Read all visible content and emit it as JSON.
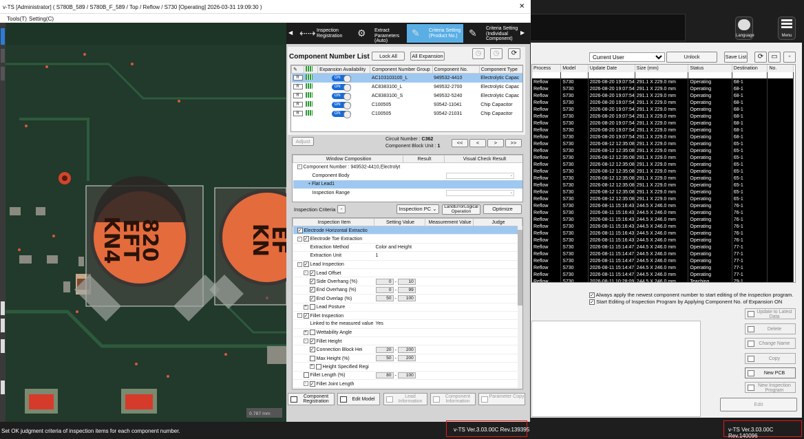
{
  "bg_app": {
    "language_label": "Language",
    "menu_label": "Menu",
    "user_select": "Current User",
    "unlock_label": "Unlock",
    "save_list_label": "Save List",
    "columns": [
      "Process",
      "Model",
      "Update Date",
      "Size (mm)",
      "Status",
      "Destination",
      "No."
    ],
    "rows": [
      [
        "Reflow",
        "S730",
        "2026-08-20 19:07:54",
        "291.1 X 229.0 mm",
        "Operating",
        "68-1"
      ],
      [
        "Reflow",
        "S730",
        "2026-08-20 19:07:54",
        "291.1 X 229.0 mm",
        "Operating",
        "68-1"
      ],
      [
        "Reflow",
        "S730",
        "2026-08-20 19:07:54",
        "291.1 X 229.0 mm",
        "Operating",
        "68-1"
      ],
      [
        "Reflow",
        "S730",
        "2026-08-20 19:07:54",
        "291.1 X 229.0 mm",
        "Operating",
        "68-1"
      ],
      [
        "Reflow",
        "S730",
        "2026-08-20 19:07:54",
        "291.1 X 229.0 mm",
        "Operating",
        "68-1"
      ],
      [
        "Reflow",
        "S730",
        "2026-08-20 19:07:54",
        "291.1 X 229.0 mm",
        "Operating",
        "68-1"
      ],
      [
        "Reflow",
        "S730",
        "2026-08-20 19:07:54",
        "291.1 X 229.0 mm",
        "Operating",
        "68-1"
      ],
      [
        "Reflow",
        "S730",
        "2026-08-20 19:07:54",
        "291.1 X 229.0 mm",
        "Operating",
        "68-1"
      ],
      [
        "Reflow",
        "S730",
        "2026-08-20 19:07:54",
        "291.1 X 229.0 mm",
        "Operating",
        "68-1"
      ],
      [
        "Reflow",
        "S730",
        "2026-08-12 12:35:08",
        "291.1 X 229.0 mm",
        "Operating",
        "65-1"
      ],
      [
        "Reflow",
        "S730",
        "2026-08-12 12:35:08",
        "291.1 X 229.0 mm",
        "Operating",
        "65-1"
      ],
      [
        "Reflow",
        "S730",
        "2026-08-12 12:35:08",
        "291.1 X 229.0 mm",
        "Operating",
        "65-1"
      ],
      [
        "Reflow",
        "S730",
        "2026-08-12 12:35:08",
        "291.1 X 229.0 mm",
        "Operating",
        "65-1"
      ],
      [
        "Reflow",
        "S730",
        "2026-08-12 12:35:08",
        "291.1 X 229.0 mm",
        "Operating",
        "65-1"
      ],
      [
        "Reflow",
        "S730",
        "2026-08-12 12:35:08",
        "291.1 X 229.0 mm",
        "Operating",
        "65-1"
      ],
      [
        "Reflow",
        "S730",
        "2026-08-12 12:35:08",
        "291.1 X 229.0 mm",
        "Operating",
        "65-1"
      ],
      [
        "Reflow",
        "S730",
        "2026-08-12 12:35:08",
        "291.1 X 229.0 mm",
        "Operating",
        "65-1"
      ],
      [
        "Reflow",
        "S730",
        "2026-08-12 12:35:08",
        "291.1 X 229.0 mm",
        "Operating",
        "65-1"
      ],
      [
        "Reflow",
        "S730",
        "2026-08-11 15:16:43",
        "244.5 X 246.0 mm",
        "Operating",
        "76-1"
      ],
      [
        "Reflow",
        "S730",
        "2026-08-11 15:16:43",
        "244.5 X 246.0 mm",
        "Operating",
        "76-1"
      ],
      [
        "Reflow",
        "S730",
        "2026-08-11 15:16:43",
        "244.5 X 246.0 mm",
        "Operating",
        "76-1"
      ],
      [
        "Reflow",
        "S730",
        "2026-08-11 15:16:43",
        "244.5 X 246.0 mm",
        "Operating",
        "76-1"
      ],
      [
        "Reflow",
        "S730",
        "2026-08-11 15:16:43",
        "244.5 X 246.0 mm",
        "Operating",
        "76-1"
      ],
      [
        "Reflow",
        "S730",
        "2026-08-11 15:16:43",
        "244.5 X 246.0 mm",
        "Operating",
        "76-1"
      ],
      [
        "Reflow",
        "S730",
        "2026-08-11 15:14:47",
        "244.5 X 246.0 mm",
        "Operating",
        "77-1"
      ],
      [
        "Reflow",
        "S730",
        "2026-08-11 15:14:47",
        "244.5 X 246.0 mm",
        "Operating",
        "77-1"
      ],
      [
        "Reflow",
        "S730",
        "2026-08-11 15:14:47",
        "244.5 X 246.0 mm",
        "Operating",
        "77-1"
      ],
      [
        "Reflow",
        "S730",
        "2026-08-11 15:14:47",
        "244.5 X 246.0 mm",
        "Operating",
        "77-1"
      ],
      [
        "Reflow",
        "S730",
        "2026-08-11 15:14:47",
        "244.5 X 246.0 mm",
        "Operating",
        "77-1"
      ],
      [
        "Reflow",
        "S730",
        "2026-08-11 10:28:09",
        "244.5 X 246.0 mm",
        "Teaching",
        "79-1"
      ]
    ],
    "option_always_apply": "Always apply the newest component number to start editing of the inspection program.",
    "option_start_editing": "Start Editing of Inspection Program by Applying Component No. of Expansion ON",
    "side_buttons": [
      "Update to Latest Data",
      "Delete",
      "Change Name",
      "Copy",
      "New PCB",
      "New Inspection Program"
    ],
    "edit_label": "Edit",
    "version": "v-TS Ver.3.03.00C Rev.140096"
  },
  "window": {
    "title": "v-TS [Administrator] ( S780B_589 / S780B_F_589 / Top / Reflow / S730 [Operating]  2026-03-31 19:09:30 )",
    "close": "✕",
    "menu": [
      "Tools(T)",
      "Setting(C)"
    ]
  },
  "tabs": [
    {
      "label": "Inspection Registration",
      "icon": "⇠⇢"
    },
    {
      "label": "Extract Parameters (Auto)",
      "icon": "⚙"
    },
    {
      "label": "Criteria Setting (Product No.)",
      "icon": "✎"
    },
    {
      "label": "Criteria Setting (Individual Component)",
      "icon": "✎"
    }
  ],
  "cnl": {
    "title": "Component Number List",
    "lock_all": "Lock All",
    "all_expansion": "All Expansion",
    "columns": [
      "Expansion Availability",
      "Component Number Group",
      "Component No.",
      "Component Type"
    ],
    "rows": [
      {
        "sw": "ON",
        "group": "AC103103100_L",
        "no": "949532-4410",
        "type": "Electrolytic Capac"
      },
      {
        "sw": "ON",
        "group": "AC8383100_L",
        "no": "949532-2700",
        "type": "Electrolytic Capac"
      },
      {
        "sw": "ON",
        "group": "AC8383100_S",
        "no": "949532-5240",
        "type": "Electrolytic Capac"
      },
      {
        "sw": "ON",
        "group": "C100505",
        "no": "93542-11041",
        "type": "Chip Capacitor"
      },
      {
        "sw": "ON",
        "group": "C100505",
        "no": "93542-21031",
        "type": "Chip Capacitor"
      }
    ],
    "adjust": "Adjust",
    "circuit_label": "Circuit Number :",
    "circuit_value": "C362",
    "block_label": "Component Block Unit :",
    "block_value": "1",
    "nav": [
      "<<",
      "<",
      ">",
      ">>"
    ]
  },
  "wc": {
    "columns": [
      "Window Composition",
      "Result",
      "Visual Check Result"
    ],
    "rows": [
      "Component Number : 949532-4410,Electrolyt",
      "Component Body",
      "Flat Lead1",
      "Inspection Range"
    ]
  },
  "criteria": {
    "label": "Inspection Criteria",
    "inspection_pc": "Inspection PC",
    "land_error": "LandErrorLogical Operation",
    "optimize": "Optimize"
  },
  "items": {
    "columns": [
      "Inspection Item",
      "Setting Value",
      "Measurement Value",
      "Judge"
    ],
    "rows": [
      {
        "name": "Electrode Horizontal Extractio",
        "lv": 0,
        "cb": true,
        "exp": "",
        "sel": true
      },
      {
        "name": "Electrode Toe Extraction",
        "lv": 0,
        "cb": true,
        "exp": "-"
      },
      {
        "name": "Extraction Method",
        "lv": 1,
        "text": "Color and Height"
      },
      {
        "name": "Extraction Unit",
        "lv": 1,
        "text": "1"
      },
      {
        "name": "Lead Inspection",
        "lv": 0,
        "cb": true,
        "exp": "-"
      },
      {
        "name": "Lead Offset",
        "lv": 1,
        "cb": true,
        "exp": "-"
      },
      {
        "name": "Side Overhang (%)",
        "lv": 2,
        "cb": true,
        "v1": "0",
        "v2": "10"
      },
      {
        "name": "End Overhang (%)",
        "lv": 2,
        "cb": true,
        "v1": "0",
        "v2": "99"
      },
      {
        "name": "End Overlap (%)",
        "lv": 2,
        "cb": true,
        "v1": "50",
        "v2": "100"
      },
      {
        "name": "Lead Posture",
        "lv": 1,
        "cb": false,
        "exp": "+"
      },
      {
        "name": "Fillet Inspection",
        "lv": 0,
        "cb": true,
        "exp": "-"
      },
      {
        "name": "Linked to the measured value",
        "lv": 1,
        "text": "Yes"
      },
      {
        "name": "Wettability Angle",
        "lv": 1,
        "cb": false,
        "exp": "+"
      },
      {
        "name": "Fillet Height",
        "lv": 1,
        "cb": true,
        "exp": "-"
      },
      {
        "name": "Connection Block Hei",
        "lv": 2,
        "cb": true,
        "v1": "20",
        "v2": "200"
      },
      {
        "name": "Max Height (%)",
        "lv": 2,
        "cb": false,
        "v1": "50",
        "v2": "200"
      },
      {
        "name": "Height Specified Regi",
        "lv": 2,
        "cb": false,
        "exp": "+"
      },
      {
        "name": "Fillet Length (%)",
        "lv": 1,
        "cb": false,
        "v1": "80",
        "v2": "100"
      },
      {
        "name": "Fillet Joint Length",
        "lv": 1,
        "cb": true,
        "exp": "-"
      }
    ]
  },
  "bottom_buttons": [
    {
      "label": "Component Registration",
      "en": true
    },
    {
      "label": "Edit Model",
      "en": true
    },
    {
      "label": "Lead Information",
      "en": false
    },
    {
      "label": "Component Information",
      "en": false
    },
    {
      "label": "Parameter Copy",
      "en": false
    }
  ],
  "pcb": {
    "cap_text1": "820",
    "cap_text2": "EFT",
    "cap_text3": "KN4",
    "cap2_text1": "EF",
    "cap2_text2": "KN",
    "scale_text": "0.787 mm"
  },
  "status": {
    "message": "Set OK judgment criteria of inspection items for each component number.",
    "version": "v-TS Ver.3.03.00C Rev.139395"
  },
  "colors": {
    "accent": "#5aaee6",
    "selected_row": "#9ec8f0",
    "highlight": "#e81818"
  }
}
